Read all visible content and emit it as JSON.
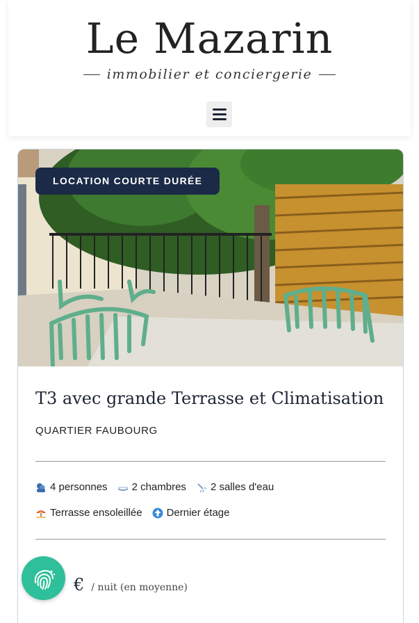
{
  "header": {
    "logo_title": "Le Mazarin",
    "logo_subtitle": "immobilier et conciergerie",
    "menu_icon": "hamburger-menu-icon"
  },
  "listing": {
    "badge": "LOCATION COURTE DURÉE",
    "title": "T3 avec grande Terrasse et Climatisation",
    "district": "QUARTIER FAUBOURG",
    "features_row1": [
      {
        "icon": "people-icon",
        "label": "4 personnes"
      },
      {
        "icon": "bed-icon",
        "label": "2 chambres"
      },
      {
        "icon": "shower-icon",
        "label": "2 salles d'eau"
      }
    ],
    "features_row2": [
      {
        "icon": "beach-umbrella-icon",
        "label": "Terrasse ensoleillée"
      },
      {
        "icon": "up-arrow-icon",
        "label": "Dernier étage"
      }
    ],
    "price_currency": "€",
    "price_note": "/ nuit (en moyenne)"
  },
  "colors": {
    "navy": "#1b2a46",
    "chat_button": "#2fbf9a",
    "card_border": "#c9d3dc"
  },
  "chat_button_icon": "fingerprint-chat-icon"
}
